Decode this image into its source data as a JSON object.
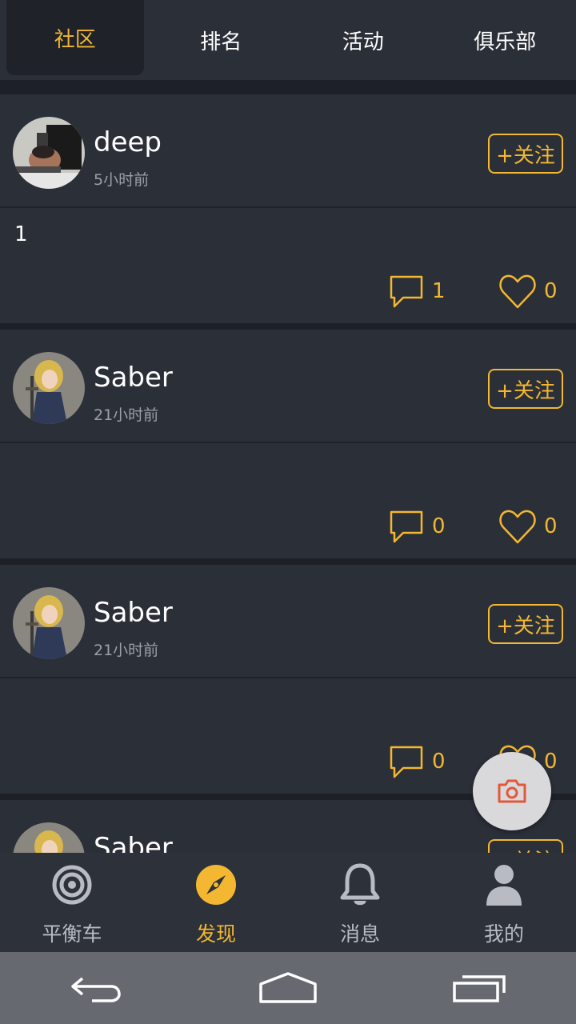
{
  "top_tabs": [
    {
      "label": "社区",
      "active": true
    },
    {
      "label": "排名",
      "active": false
    },
    {
      "label": "活动",
      "active": false
    },
    {
      "label": "俱乐部",
      "active": false
    }
  ],
  "posts": [
    {
      "username": "deep",
      "time": "5小时前",
      "follow_label": "+关注",
      "text": "1",
      "comments": "1",
      "likes": "0",
      "avatar": "deep-avatar"
    },
    {
      "username": "Saber",
      "time": "21小时前",
      "follow_label": "+关注",
      "text": "",
      "comments": "0",
      "likes": "0",
      "avatar": "saber-avatar"
    },
    {
      "username": "Saber",
      "time": "21小时前",
      "follow_label": "+关注",
      "text": "",
      "comments": "0",
      "likes": "0",
      "avatar": "saber-avatar"
    },
    {
      "username": "Saber",
      "time": "",
      "follow_label": "+关注",
      "text": "",
      "comments": "",
      "likes": "",
      "avatar": "saber-avatar"
    }
  ],
  "fab": {
    "icon": "camera-icon"
  },
  "bottom_nav": [
    {
      "label": "平衡车",
      "icon": "target-icon",
      "active": false
    },
    {
      "label": "发现",
      "icon": "compass-icon",
      "active": true
    },
    {
      "label": "消息",
      "icon": "bell-icon",
      "active": false
    },
    {
      "label": "我的",
      "icon": "person-icon",
      "active": false
    }
  ],
  "system_nav": [
    "back-icon",
    "home-icon",
    "recents-icon"
  ],
  "colors": {
    "accent": "#f3b731",
    "background": "#2b2f38",
    "divider": "#1d2026"
  }
}
